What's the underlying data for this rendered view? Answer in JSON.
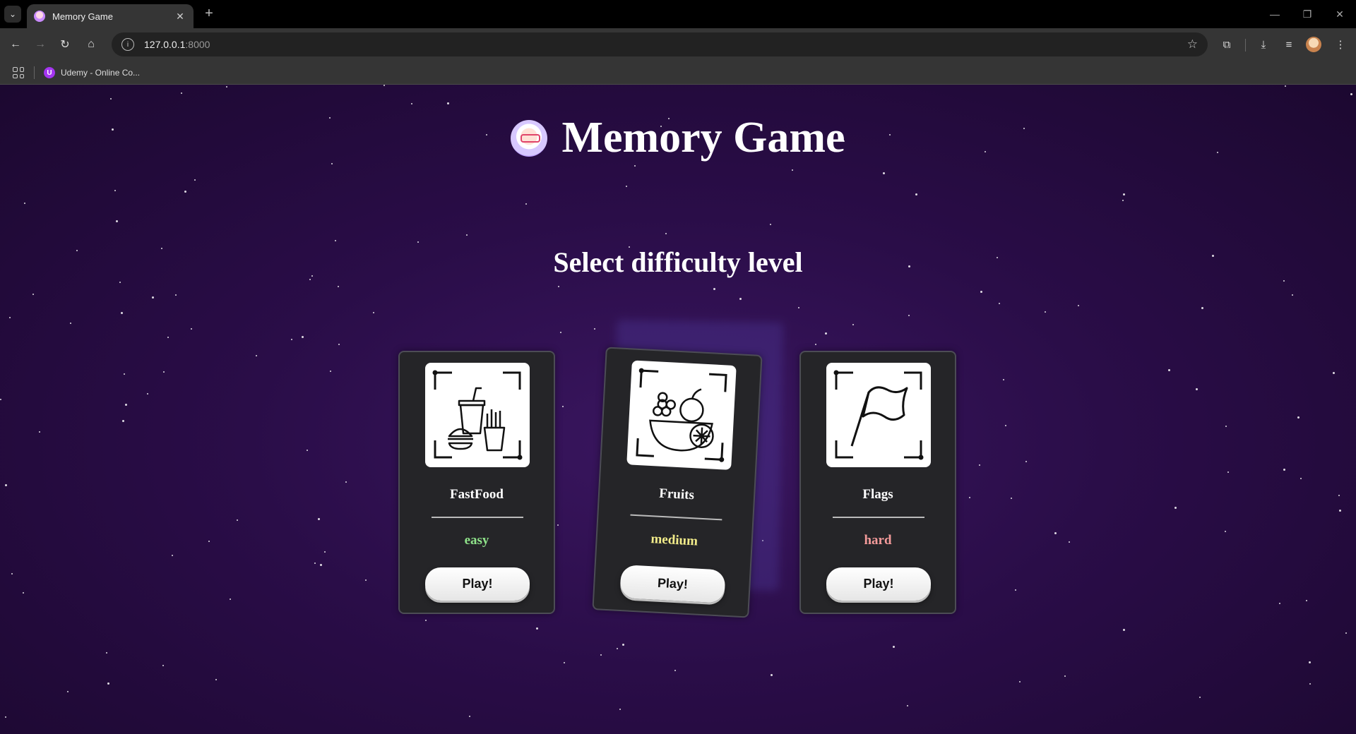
{
  "browser": {
    "tab_title": "Memory Game",
    "url_host": "127.0.0.1",
    "url_port": ":8000",
    "bookmark_label": "Udemy - Online Co...",
    "bookmark_favicon_letter": "U"
  },
  "page": {
    "title": "Memory Game",
    "subtitle": "Select difficulty level"
  },
  "cards": [
    {
      "name": "FastFood",
      "level": "easy",
      "level_color": "#8fe38a",
      "button": "Play!",
      "icon": "fastfood-icon"
    },
    {
      "name": "Fruits",
      "level": "medium",
      "level_color": "#f2ec8a",
      "button": "Play!",
      "icon": "fruits-icon"
    },
    {
      "name": "Flags",
      "level": "hard",
      "level_color": "#f39a9a",
      "button": "Play!",
      "icon": "flag-icon"
    }
  ],
  "colors": {
    "background": "#2a0d48",
    "card": "#252528"
  }
}
